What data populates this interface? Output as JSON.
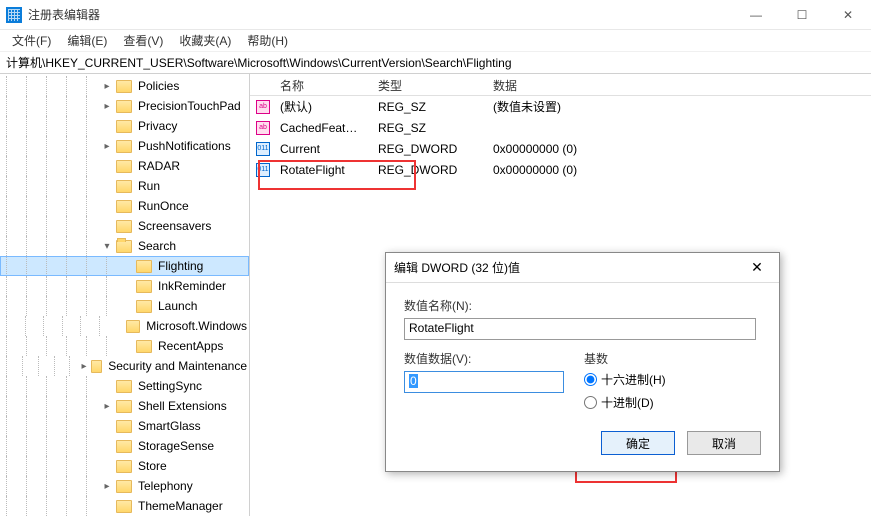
{
  "window": {
    "title": "注册表编辑器"
  },
  "menu": [
    {
      "label": "文件(F)"
    },
    {
      "label": "编辑(E)"
    },
    {
      "label": "查看(V)"
    },
    {
      "label": "收藏夹(A)"
    },
    {
      "label": "帮助(H)"
    }
  ],
  "address": "计算机\\HKEY_CURRENT_USER\\Software\\Microsoft\\Windows\\CurrentVersion\\Search\\Flighting",
  "tree": [
    {
      "depth": 5,
      "toggle": ">",
      "label": "Policies"
    },
    {
      "depth": 5,
      "toggle": ">",
      "label": "PrecisionTouchPad"
    },
    {
      "depth": 5,
      "toggle": "",
      "label": "Privacy"
    },
    {
      "depth": 5,
      "toggle": ">",
      "label": "PushNotifications"
    },
    {
      "depth": 5,
      "toggle": "",
      "label": "RADAR"
    },
    {
      "depth": 5,
      "toggle": "",
      "label": "Run"
    },
    {
      "depth": 5,
      "toggle": "",
      "label": "RunOnce"
    },
    {
      "depth": 5,
      "toggle": "",
      "label": "Screensavers"
    },
    {
      "depth": 5,
      "toggle": "v",
      "label": "Search",
      "open": true
    },
    {
      "depth": 6,
      "toggle": "",
      "label": "Flighting",
      "selected": true
    },
    {
      "depth": 6,
      "toggle": "",
      "label": "InkReminder"
    },
    {
      "depth": 6,
      "toggle": "",
      "label": "Launch"
    },
    {
      "depth": 6,
      "toggle": "",
      "label": "Microsoft.Windows"
    },
    {
      "depth": 6,
      "toggle": "",
      "label": "RecentApps"
    },
    {
      "depth": 5,
      "toggle": ">",
      "label": "Security and Maintenance"
    },
    {
      "depth": 5,
      "toggle": "",
      "label": "SettingSync"
    },
    {
      "depth": 5,
      "toggle": ">",
      "label": "Shell Extensions"
    },
    {
      "depth": 5,
      "toggle": "",
      "label": "SmartGlass"
    },
    {
      "depth": 5,
      "toggle": "",
      "label": "StorageSense"
    },
    {
      "depth": 5,
      "toggle": "",
      "label": "Store"
    },
    {
      "depth": 5,
      "toggle": ">",
      "label": "Telephony"
    },
    {
      "depth": 5,
      "toggle": "",
      "label": "ThemeManager"
    }
  ],
  "columns": {
    "name": "名称",
    "type": "类型",
    "data": "数据"
  },
  "values": [
    {
      "icon": "sz",
      "name": "(默认)",
      "type": "REG_SZ",
      "data": "(数值未设置)"
    },
    {
      "icon": "sz",
      "name": "CachedFeature...",
      "type": "REG_SZ",
      "data": ""
    },
    {
      "icon": "dw",
      "name": "Current",
      "type": "REG_DWORD",
      "data": "0x00000000 (0)"
    },
    {
      "icon": "dw",
      "name": "RotateFlight",
      "type": "REG_DWORD",
      "data": "0x00000000 (0)"
    }
  ],
  "dialog": {
    "title": "编辑 DWORD (32 位)值",
    "name_label": "数值名称(N):",
    "name_value": "RotateFlight",
    "data_label": "数值数据(V):",
    "data_value": "0",
    "base_label": "基数",
    "radix_hex": "十六进制(H)",
    "radix_dec": "十进制(D)",
    "ok": "确定",
    "cancel": "取消"
  }
}
